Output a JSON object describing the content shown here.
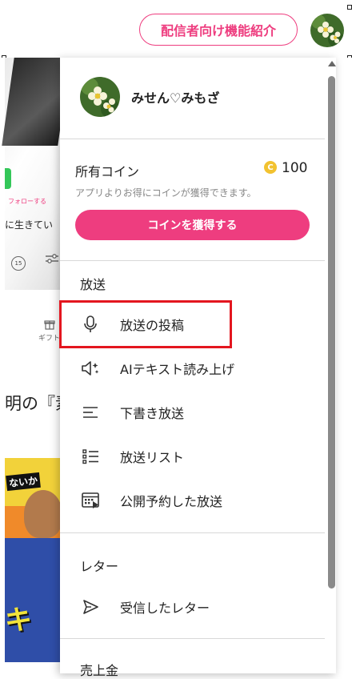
{
  "header": {
    "promo_button": "配信者向け機能紹介",
    "avatar_icon": "flower-avatar-icon"
  },
  "background": {
    "follow_text": "フォローする",
    "live_text": "に生きてい",
    "skip_label": "15",
    "gift_label": "ギフト",
    "caption": "明の『素",
    "poster_text": "ないか",
    "poster_big": "キ"
  },
  "panel": {
    "user": {
      "name": "みせん♡みもざ"
    },
    "coin": {
      "label": "所有コイン",
      "icon": "C",
      "amount": "100",
      "note": "アプリよりお得にコインが獲得できます。",
      "button": "コインを獲得する"
    },
    "broadcast_section": {
      "title": "放送",
      "items": [
        {
          "label": "放送の投稿",
          "icon": "microphone-icon"
        },
        {
          "label": "AIテキスト読み上げ",
          "icon": "ai-speaker-icon"
        },
        {
          "label": "下書き放送",
          "icon": "draft-lines-icon"
        },
        {
          "label": "放送リスト",
          "icon": "list-icon"
        },
        {
          "label": "公開予約した放送",
          "icon": "scheduled-calendar-icon"
        }
      ]
    },
    "letter_section": {
      "title": "レター",
      "items": [
        {
          "label": "受信したレター",
          "icon": "send-arrow-icon"
        }
      ]
    },
    "sales_section": {
      "title": "売上金"
    }
  },
  "colors": {
    "accent": "#ee3d7f",
    "highlight": "#e3161f",
    "coin": "#f2c230"
  }
}
